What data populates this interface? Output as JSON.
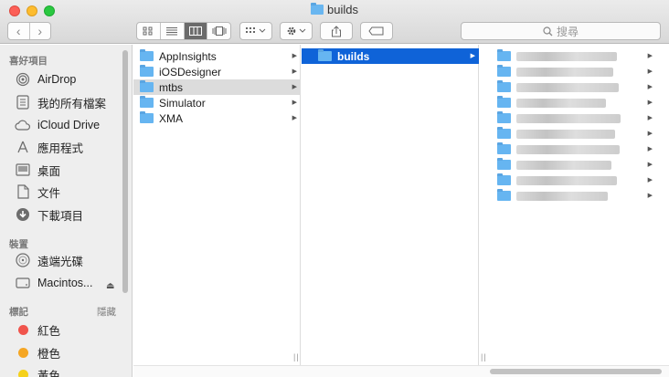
{
  "window": {
    "title": "builds"
  },
  "toolbar": {
    "back_glyph": "‹",
    "forward_glyph": "›",
    "search_placeholder": "搜尋",
    "icons": [
      "grid-view-icon",
      "list-view-icon",
      "column-view-icon",
      "coverflow-view-icon",
      "arrange-icon",
      "gear-icon",
      "share-icon",
      "tag-icon",
      "search-icon"
    ]
  },
  "sidebar": {
    "favorites_header": "喜好項目",
    "favorites": [
      {
        "label": "AirDrop",
        "icon": "airdrop-icon"
      },
      {
        "label": "我的所有檔案",
        "icon": "all-files-icon"
      },
      {
        "label": "iCloud Drive",
        "icon": "cloud-icon"
      },
      {
        "label": "應用程式",
        "icon": "applications-icon"
      },
      {
        "label": "桌面",
        "icon": "desktop-icon"
      },
      {
        "label": "文件",
        "icon": "document-icon"
      },
      {
        "label": "下載項目",
        "icon": "download-icon"
      }
    ],
    "devices_header": "裝置",
    "devices": [
      {
        "label": "遠端光碟",
        "icon": "remote-disc-icon"
      },
      {
        "label": "Macintos...",
        "icon": "hard-drive-icon"
      }
    ],
    "eject_glyph": "⏏",
    "tags_header": "標記",
    "tags_hide": "隱藏",
    "tags": [
      {
        "label": "紅色",
        "color": "#f0544c"
      },
      {
        "label": "橙色",
        "color": "#f5a623"
      },
      {
        "label": "黃色",
        "color": "#f5d11b"
      }
    ]
  },
  "columns": {
    "col1": [
      "AppInsights",
      "iOSDesigner",
      "mtbs",
      "Simulator",
      "XMA"
    ],
    "col1_selected": "mtbs",
    "col2": [
      "builds"
    ],
    "col2_selected": "builds",
    "col3_item_count": 10
  },
  "colors": {
    "selection_blue": "#0f63d8",
    "selection_gray": "#dcdcdc",
    "folder_blue": "#66b5f1"
  }
}
